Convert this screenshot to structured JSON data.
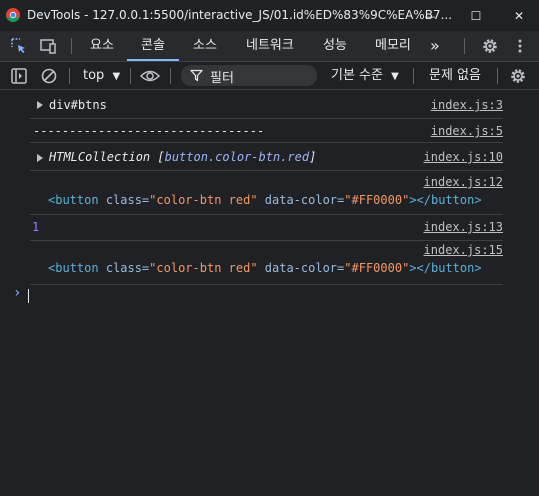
{
  "window": {
    "title": "DevTools - 127.0.0.1:5500/interactive_JS/01.id%ED%83%9C%EA%B7...",
    "minimize_glyph": "—",
    "maximize_glyph": "☐",
    "close_glyph": "✕"
  },
  "tabs": [
    {
      "label": "요소",
      "active": false
    },
    {
      "label": "콘솔",
      "active": true
    },
    {
      "label": "소스",
      "active": false
    },
    {
      "label": "네트워크",
      "active": false
    },
    {
      "label": "성능",
      "active": false
    },
    {
      "label": "메모리",
      "active": false
    }
  ],
  "tabs_more_glyph": "»",
  "toolbar": {
    "context": "top",
    "filter_placeholder": "필터",
    "levels": "기본 수준",
    "issues": "문제 없음"
  },
  "console": {
    "messages": [
      {
        "type": "object",
        "text": "div#btns",
        "source": "index.js:3"
      },
      {
        "type": "log",
        "text": "--------------------------------",
        "source": "index.js:5"
      },
      {
        "type": "collection",
        "prefix": "HTMLCollection [",
        "inner": "button.color-btn.red",
        "suffix": "]",
        "source": "index.js:10"
      },
      {
        "type": "element",
        "open_tag": "<button",
        "attr1": "class=",
        "val1": "\"color-btn red\"",
        "attr2": "data-color=",
        "val2": "\"#FF0000\"",
        "close_tag": "></button>",
        "source": "index.js:12"
      },
      {
        "type": "number",
        "text": "1",
        "source": "index.js:13"
      },
      {
        "type": "element",
        "open_tag": "<button",
        "attr1": "class=",
        "val1": "\"color-btn red\"",
        "attr2": "data-color=",
        "val2": "\"#FF0000\"",
        "close_tag": "></button>",
        "source": "index.js:15"
      }
    ],
    "prompt_glyph": "›"
  },
  "colors": {
    "background": "#202124",
    "accent": "#8ab4f8",
    "text": "#e8eaed"
  }
}
